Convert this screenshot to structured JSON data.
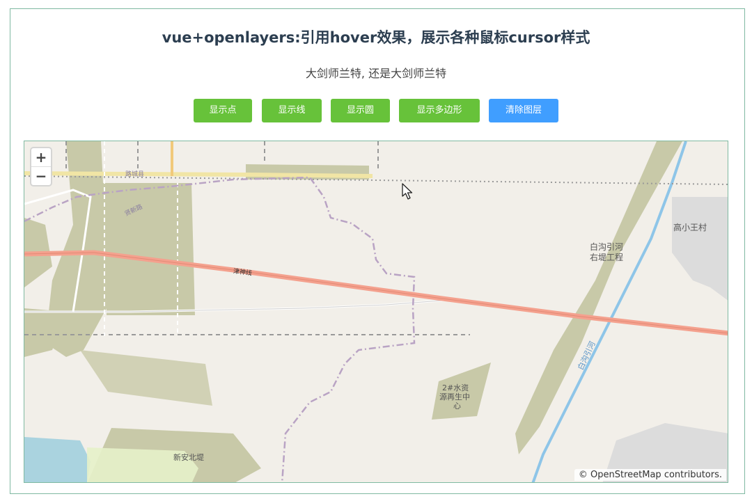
{
  "header": {
    "title": "vue+openlayers:引用hover效果，展示各种鼠标cursor样式",
    "subtitle": "大剑师兰特, 还是大剑师兰特"
  },
  "toolbar": {
    "buttons": [
      {
        "label": "显示点"
      },
      {
        "label": "显示线"
      },
      {
        "label": "显示圆"
      },
      {
        "label": "显示多边形"
      },
      {
        "label": "清除图层"
      }
    ]
  },
  "map": {
    "zoom_in": "+",
    "zoom_out": "−",
    "attribution": "© OpenStreetMap contributors.",
    "labels": {
      "gaoxiaowang": "高小王村",
      "baigou_1": "白沟引河",
      "baigou_2": "右堤工程",
      "water_1": "2#水资",
      "water_2": "源再生中",
      "water_3": "心",
      "xinan": "新安北堤",
      "railway": "津神线",
      "baigou_river": "白沟引河",
      "road_top": "路城县",
      "road_left": "贤新路"
    }
  },
  "colors": {
    "green_button": "#67c23a",
    "blue_button": "#409eff",
    "railway": "#f4a18e",
    "river": "#8ec5e8"
  }
}
